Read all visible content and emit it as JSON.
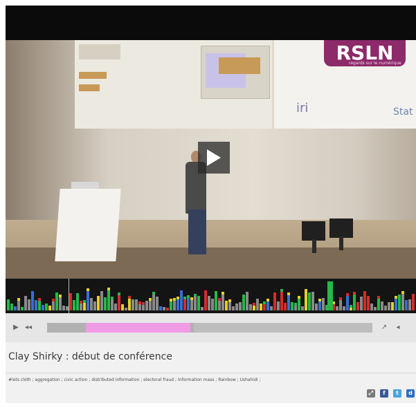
{
  "video": {
    "slide_logo": "RSLN",
    "slide_logo_sub": "regards sur le numérique",
    "slide_iri": "iri",
    "slide_stat": "Stat"
  },
  "controls": {
    "progress": {
      "buffered": 0.45,
      "segment_start": 0.12,
      "segment_end": 0.44
    }
  },
  "title": "Clay Shirky : début de conférence",
  "tags": "#lets cloth ; aggregation ; civic action ; distributed information ; electoral fraud ; Information mass ; Rainbow ; Ushahidi ;",
  "share": {
    "icons": [
      "share-icon",
      "facebook-icon",
      "twitter-icon",
      "delicious-icon"
    ]
  },
  "colors": {
    "timeline_bg": "#141414",
    "segment_pink": "#f09be6",
    "bar_gray": "#8a8a8a",
    "bar_green": "#25b84a",
    "bar_red": "#d62b2b",
    "bar_yellow": "#e6cf28",
    "bar_blue": "#3a6fd0"
  }
}
